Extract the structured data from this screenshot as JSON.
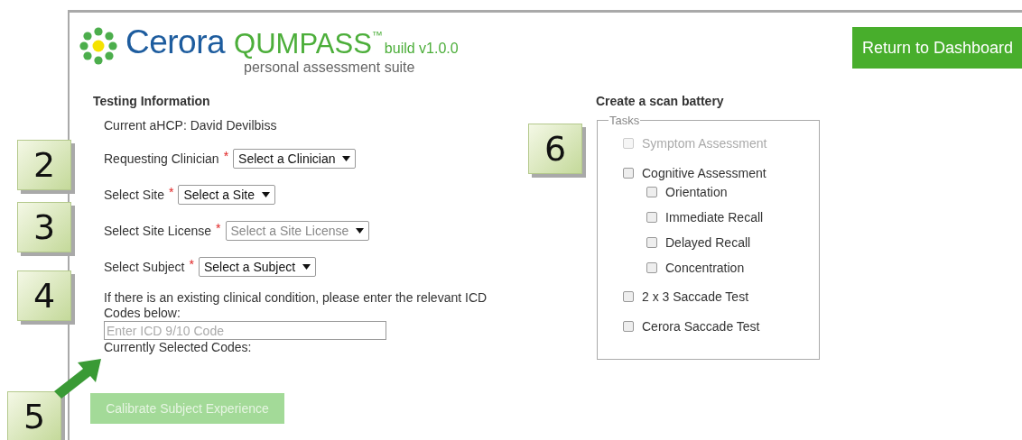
{
  "header": {
    "brand": "Cerora",
    "product": "QUMPASS",
    "trademark": "™",
    "build": "build v1.0.0",
    "tagline": "personal assessment suite",
    "return_button": "Return to Dashboard"
  },
  "testing_information": {
    "title": "Testing Information",
    "current_ahcp": "Current aHCP: David Devilbiss",
    "fields": [
      {
        "label": "Requesting Clinician",
        "required_mark": "*",
        "value": "Select a Clinician",
        "disabled": false
      },
      {
        "label": "Select Site",
        "required_mark": "*",
        "value": "Select a Site",
        "disabled": false
      },
      {
        "label": "Select Site License",
        "required_mark": "*",
        "value": "Select a Site License",
        "disabled": true
      },
      {
        "label": "Select Subject",
        "required_mark": "*",
        "value": "Select a Subject",
        "disabled": false
      }
    ],
    "icd_prompt": "If there is an existing clinical condition, please enter the relevant ICD Codes below:",
    "icd_input": {
      "placeholder": "Enter ICD 9/10 Code"
    },
    "selected_codes_label": "Currently Selected Codes:",
    "calibrate_button": {
      "label": "Calibrate Subject Experience",
      "disabled": true
    }
  },
  "scan_battery": {
    "title": "Create a scan battery",
    "legend": "Tasks",
    "tasks": [
      {
        "label": "Symptom Assessment",
        "checked": false,
        "disabled": true
      },
      {
        "label": "Cognitive Assessment",
        "checked": false,
        "disabled": false,
        "children": [
          {
            "label": "Orientation",
            "checked": false,
            "disabled": false
          },
          {
            "label": "Immediate Recall",
            "checked": false,
            "disabled": false
          },
          {
            "label": "Delayed Recall",
            "checked": false,
            "disabled": false
          },
          {
            "label": "Concentration",
            "checked": false,
            "disabled": false
          }
        ]
      },
      {
        "label": "2 x 3 Saccade Test",
        "checked": false,
        "disabled": false
      },
      {
        "label": "Cerora Saccade Test",
        "checked": false,
        "disabled": false
      }
    ]
  },
  "callouts": [
    {
      "label": "2"
    },
    {
      "label": "3"
    },
    {
      "label": "4"
    },
    {
      "label": "5"
    },
    {
      "label": "6"
    }
  ]
}
